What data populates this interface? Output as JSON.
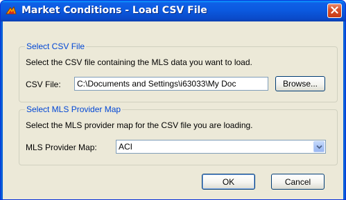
{
  "window": {
    "title": "Market Conditions - Load CSV File"
  },
  "csv_group": {
    "legend": "Select CSV File",
    "description": "Select the CSV file containing the MLS data you want to load.",
    "field_label": "CSV File:",
    "field_value": "C:\\Documents and Settings\\i63033\\My Doc",
    "browse_label": "Browse..."
  },
  "map_group": {
    "legend": "Select MLS Provider Map",
    "description": "Select the MLS provider map for the CSV file you are loading.",
    "field_label": "MLS Provider Map:",
    "selected_value": "ACI"
  },
  "buttons": {
    "ok_label": "OK",
    "cancel_label": "Cancel"
  },
  "icons": {
    "app": "app-logo-icon",
    "close": "close-icon",
    "dropdown": "chevron-down-icon"
  },
  "colors": {
    "titlebar": "#0a5fd8",
    "client_bg": "#ece9d8",
    "legend_text": "#0046d5",
    "close_button": "#d8512b"
  }
}
